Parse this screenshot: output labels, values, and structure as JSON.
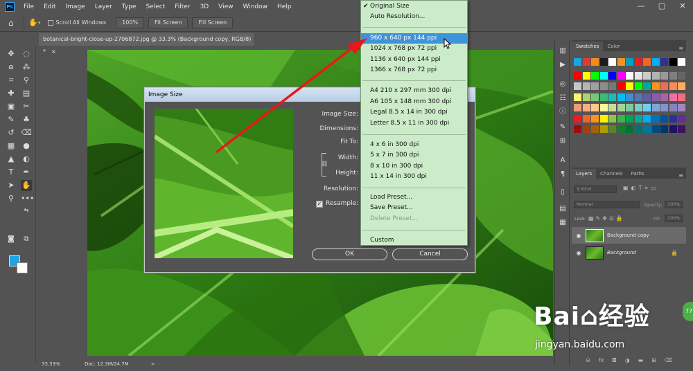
{
  "app": {
    "logo_text": "Ps",
    "menus": [
      "File",
      "Edit",
      "Image",
      "Layer",
      "Type",
      "Select",
      "Filter",
      "3D",
      "View",
      "Window",
      "Help"
    ],
    "window_controls": [
      "—",
      "▢",
      "✕"
    ]
  },
  "options": {
    "scroll_all_label": "Scroll All Windows",
    "zoom_btn": "100%",
    "fit_btn": "Fit Screen",
    "fill_btn": "Fill Screen"
  },
  "document": {
    "tab_title": "botanical-bright-close-up-2706872.jpg @ 33.3% (Background copy, RGB/8) *",
    "tab_close": "×",
    "status_zoom": "33.33%",
    "status_doc": "Doc: 12.3M/24.7M",
    "status_arrow": ">"
  },
  "dialog": {
    "title": "Image Size",
    "image_size_label": "Image Size:",
    "dimensions_label": "Dimensions:",
    "fit_to_label": "Fit To:",
    "width_label": "Width:",
    "height_label": "Height:",
    "resolution_label": "Resolution:",
    "resample_label": "Resample:",
    "resample_checked": true,
    "ok_label": "OK",
    "cancel_label": "Cancel"
  },
  "fit_to_menu": {
    "items": [
      {
        "label": "Original Size",
        "checked": true
      },
      {
        "label": "Auto Resolution..."
      },
      {
        "label": "960 x 640 px 144 ppi",
        "highlighted": true
      },
      {
        "label": "1024 x 768 px 72 ppi"
      },
      {
        "label": "1136 x 640 px 144 ppi"
      },
      {
        "label": "1366 x 768 px 72 ppi"
      },
      {
        "label": "A4 210 x 297 mm 300 dpi"
      },
      {
        "label": "A6 105 x 148 mm 300 dpi"
      },
      {
        "label": "Legal 8.5 x 14 in 300 dpi"
      },
      {
        "label": "Letter 8.5 x 11 in 300 dpi"
      },
      {
        "label": "4 x 6 in 300 dpi"
      },
      {
        "label": "5 x 7 in 300 dpi"
      },
      {
        "label": "8 x 10 in 300 dpi"
      },
      {
        "label": "11 x 14 in 300 dpi"
      },
      {
        "label": "Load Preset..."
      },
      {
        "label": "Save Preset..."
      },
      {
        "label": "Delete Preset...",
        "disabled": true
      },
      {
        "label": "Custom"
      }
    ]
  },
  "swatches_panel": {
    "tabs": [
      "Swatches",
      "Color"
    ],
    "colors": [
      [
        "#1aa3e6",
        "#e53a2a",
        "#f28c1c",
        "#1c1c1c",
        "#ffffff",
        "#f7941d",
        "#00a0c6",
        "#ed1c24",
        "#f26522",
        "#00aeef",
        "#2e3192",
        "#000000",
        "#ffffff"
      ],
      [
        "#ff0000",
        "#ffff00",
        "#00ff00",
        "#00ffff",
        "#0000ff",
        "#ff00ff",
        "#ffffff",
        "#e6e6e6",
        "#cccccc",
        "#b3b3b3",
        "#999999",
        "#808080",
        "#666666"
      ],
      [
        "#c7c7c7",
        "#b5b5b5",
        "#a0a0a0",
        "#8c8c8c",
        "#777777",
        "#ff0000",
        "#ffff00",
        "#00ff00",
        "#00a99d",
        "#f7941d",
        "#f26c4f",
        "#f68e56",
        "#fbaf5d"
      ],
      [
        "#fff568",
        "#acd373",
        "#7cc576",
        "#3cb878",
        "#1cbbb4",
        "#00bff3",
        "#448ccb",
        "#5574b9",
        "#605ca8",
        "#8560a8",
        "#a864a8",
        "#f06eaa",
        "#f26d7d"
      ],
      [
        "#f7977a",
        "#f9ad81",
        "#fdc68a",
        "#fff799",
        "#c4df9b",
        "#a3d39c",
        "#82ca9d",
        "#7bcdc8",
        "#6ecff6",
        "#7ea7d8",
        "#8493ca",
        "#8882be",
        "#a187be"
      ],
      [
        "#ed1c24",
        "#f26522",
        "#f7941d",
        "#fff200",
        "#8dc73f",
        "#39b54a",
        "#00a651",
        "#00a99d",
        "#00aeef",
        "#0072bc",
        "#0054a6",
        "#2e3192",
        "#662d91"
      ],
      [
        "#9e0b0f",
        "#a0410d",
        "#a3620a",
        "#aba000",
        "#598527",
        "#197b30",
        "#007236",
        "#00746b",
        "#0076a3",
        "#004a80",
        "#003471",
        "#1b1464",
        "#440e62"
      ]
    ]
  },
  "layers_panel": {
    "tabs": [
      "Layers",
      "Channels",
      "Paths"
    ],
    "kind_label": "Kind",
    "blend_mode": "Normal",
    "opacity_label": "Opacity:",
    "opacity_value": "100%",
    "lock_label": "Lock:",
    "fill_label": "Fill:",
    "fill_value": "100%",
    "layers": [
      {
        "name": "Background copy",
        "selected": true
      },
      {
        "name": "Background",
        "locked": true
      }
    ],
    "footer_icons": [
      "⊝",
      "fx",
      "◘",
      "◑",
      "▬",
      "⊞",
      "⌫"
    ]
  },
  "watermark": {
    "logo": "Bai⌂经验",
    "url": "jingyan.baidu.com",
    "badge": "77"
  }
}
